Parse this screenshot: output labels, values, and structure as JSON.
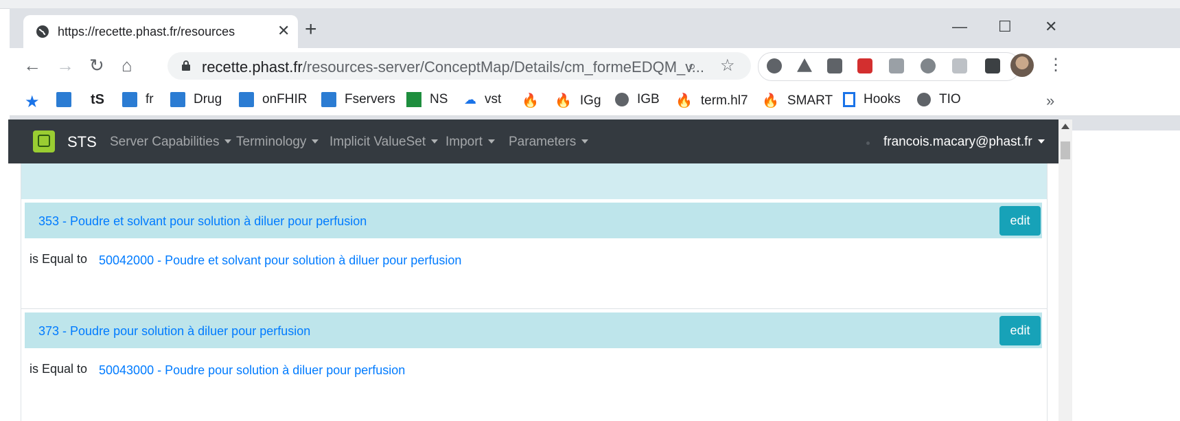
{
  "browser": {
    "tab_title": "https://recette.phast.fr/resources",
    "new_tab": "+",
    "url_host": "recette.phast.fr",
    "url_path": "/resources-server/ConceptMap/Details/cm_formeEDQM_v...",
    "bookmarks": [
      {
        "label": "",
        "icon": "browse-snomed-icon"
      },
      {
        "label": "",
        "icon": "ts-text-icon",
        "glyph": "tS"
      },
      {
        "label": "fr",
        "icon": "conf-snomed-icon"
      },
      {
        "label": "Drug",
        "icon": "conf-snomed-icon"
      },
      {
        "label": "onFHIR",
        "icon": "conf-snomed-icon"
      },
      {
        "label": "Fservers",
        "icon": "conf-snomed-icon"
      },
      {
        "label": "NS",
        "icon": "green-plus-icon"
      },
      {
        "label": "vst",
        "icon": "cloud-icon"
      },
      {
        "label": "",
        "icon": "fire-icon"
      },
      {
        "label": "IGg",
        "icon": "fire-icon"
      },
      {
        "label": "IGB",
        "icon": "globe-icon"
      },
      {
        "label": "term.hl7",
        "icon": "fire-icon"
      },
      {
        "label": "SMART",
        "icon": "fire-icon"
      },
      {
        "label": "Hooks",
        "icon": "bucket-icon"
      },
      {
        "label": "TIO",
        "icon": "globe-icon"
      }
    ],
    "more": "»"
  },
  "navbar": {
    "brand": "STS",
    "items": [
      "Server Capabilities",
      "Terminology",
      "Implicit ValueSet",
      "Import",
      "Parameters"
    ],
    "user": "francois.macary@phast.fr"
  },
  "mappings": [
    {
      "source": "353 - Poudre et solvant pour solution à diluer pour perfusion",
      "edit_label": "edit",
      "relationship": "is Equal to",
      "target": "50042000 - Poudre et solvant pour solution à diluer pour perfusion"
    },
    {
      "source": "373 - Poudre pour solution à diluer pour perfusion",
      "edit_label": "edit",
      "relationship": "is Equal to",
      "target": "50043000 - Poudre pour solution à diluer pour perfusion"
    }
  ],
  "colors": {
    "navbar_bg": "#343a40",
    "card_header_bg": "#bee5eb",
    "top_band_bg": "#d1ecf1",
    "edit_button_bg": "#17a2b8",
    "link": "#007bff"
  }
}
